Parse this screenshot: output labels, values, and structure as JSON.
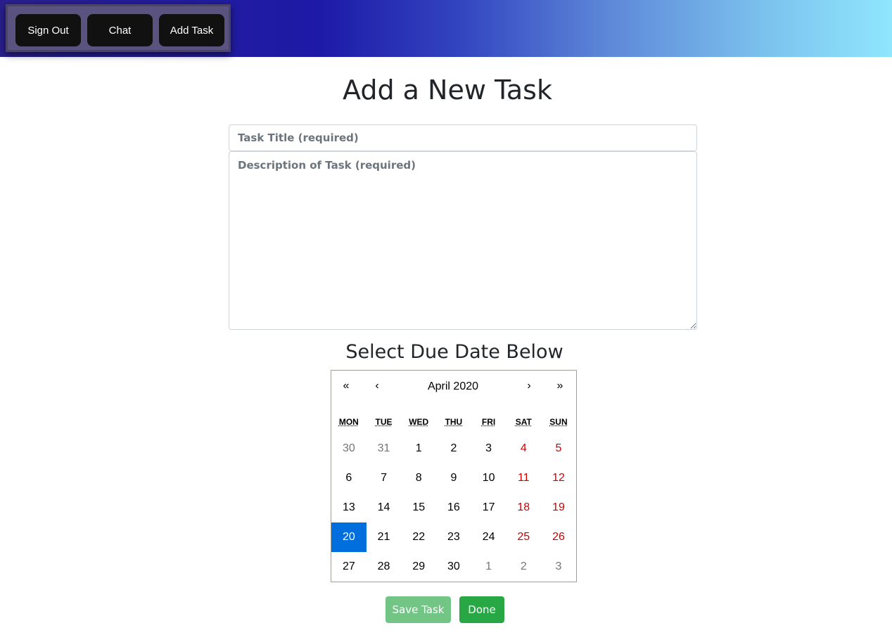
{
  "nav": {
    "sign_out_label": "Sign Out",
    "chat_label": "Chat",
    "add_task_label": "Add Task"
  },
  "form": {
    "heading": "Add a New Task",
    "title_value": "",
    "title_placeholder": "Task Title (required)",
    "description_value": "",
    "description_placeholder": "Description of Task (required)",
    "due_date_heading": "Select Due Date Below"
  },
  "calendar": {
    "nav": {
      "prev_year": "«",
      "prev_month": "‹",
      "next_month": "›",
      "next_year": "»"
    },
    "month_label": "April 2020",
    "weekdays": [
      "MON",
      "TUE",
      "WED",
      "THU",
      "FRI",
      "SAT",
      "SUN"
    ],
    "days": [
      {
        "label": "30",
        "neighbor": true,
        "weekend": false
      },
      {
        "label": "31",
        "neighbor": true,
        "weekend": false
      },
      {
        "label": "1",
        "neighbor": false,
        "weekend": false
      },
      {
        "label": "2",
        "neighbor": false,
        "weekend": false
      },
      {
        "label": "3",
        "neighbor": false,
        "weekend": false
      },
      {
        "label": "4",
        "neighbor": false,
        "weekend": true
      },
      {
        "label": "5",
        "neighbor": false,
        "weekend": true
      },
      {
        "label": "6",
        "neighbor": false,
        "weekend": false
      },
      {
        "label": "7",
        "neighbor": false,
        "weekend": false
      },
      {
        "label": "8",
        "neighbor": false,
        "weekend": false
      },
      {
        "label": "9",
        "neighbor": false,
        "weekend": false
      },
      {
        "label": "10",
        "neighbor": false,
        "weekend": false
      },
      {
        "label": "11",
        "neighbor": false,
        "weekend": true
      },
      {
        "label": "12",
        "neighbor": false,
        "weekend": true
      },
      {
        "label": "13",
        "neighbor": false,
        "weekend": false
      },
      {
        "label": "14",
        "neighbor": false,
        "weekend": false
      },
      {
        "label": "15",
        "neighbor": false,
        "weekend": false
      },
      {
        "label": "16",
        "neighbor": false,
        "weekend": false
      },
      {
        "label": "17",
        "neighbor": false,
        "weekend": false
      },
      {
        "label": "18",
        "neighbor": false,
        "weekend": true
      },
      {
        "label": "19",
        "neighbor": false,
        "weekend": true
      },
      {
        "label": "20",
        "neighbor": false,
        "weekend": false,
        "selected": true
      },
      {
        "label": "21",
        "neighbor": false,
        "weekend": false
      },
      {
        "label": "22",
        "neighbor": false,
        "weekend": false
      },
      {
        "label": "23",
        "neighbor": false,
        "weekend": false
      },
      {
        "label": "24",
        "neighbor": false,
        "weekend": false
      },
      {
        "label": "25",
        "neighbor": false,
        "weekend": true
      },
      {
        "label": "26",
        "neighbor": false,
        "weekend": true
      },
      {
        "label": "27",
        "neighbor": false,
        "weekend": false
      },
      {
        "label": "28",
        "neighbor": false,
        "weekend": false
      },
      {
        "label": "29",
        "neighbor": false,
        "weekend": false
      },
      {
        "label": "30",
        "neighbor": false,
        "weekend": false
      },
      {
        "label": "1",
        "neighbor": true,
        "weekend": false
      },
      {
        "label": "2",
        "neighbor": true,
        "weekend": true
      },
      {
        "label": "3",
        "neighbor": true,
        "weekend": true
      }
    ]
  },
  "actions": {
    "save_label": "Save Task",
    "done_label": "Done"
  },
  "colors": {
    "selected_day": "#006edc",
    "weekend_day": "#d10000",
    "success_button": "#28a745"
  }
}
